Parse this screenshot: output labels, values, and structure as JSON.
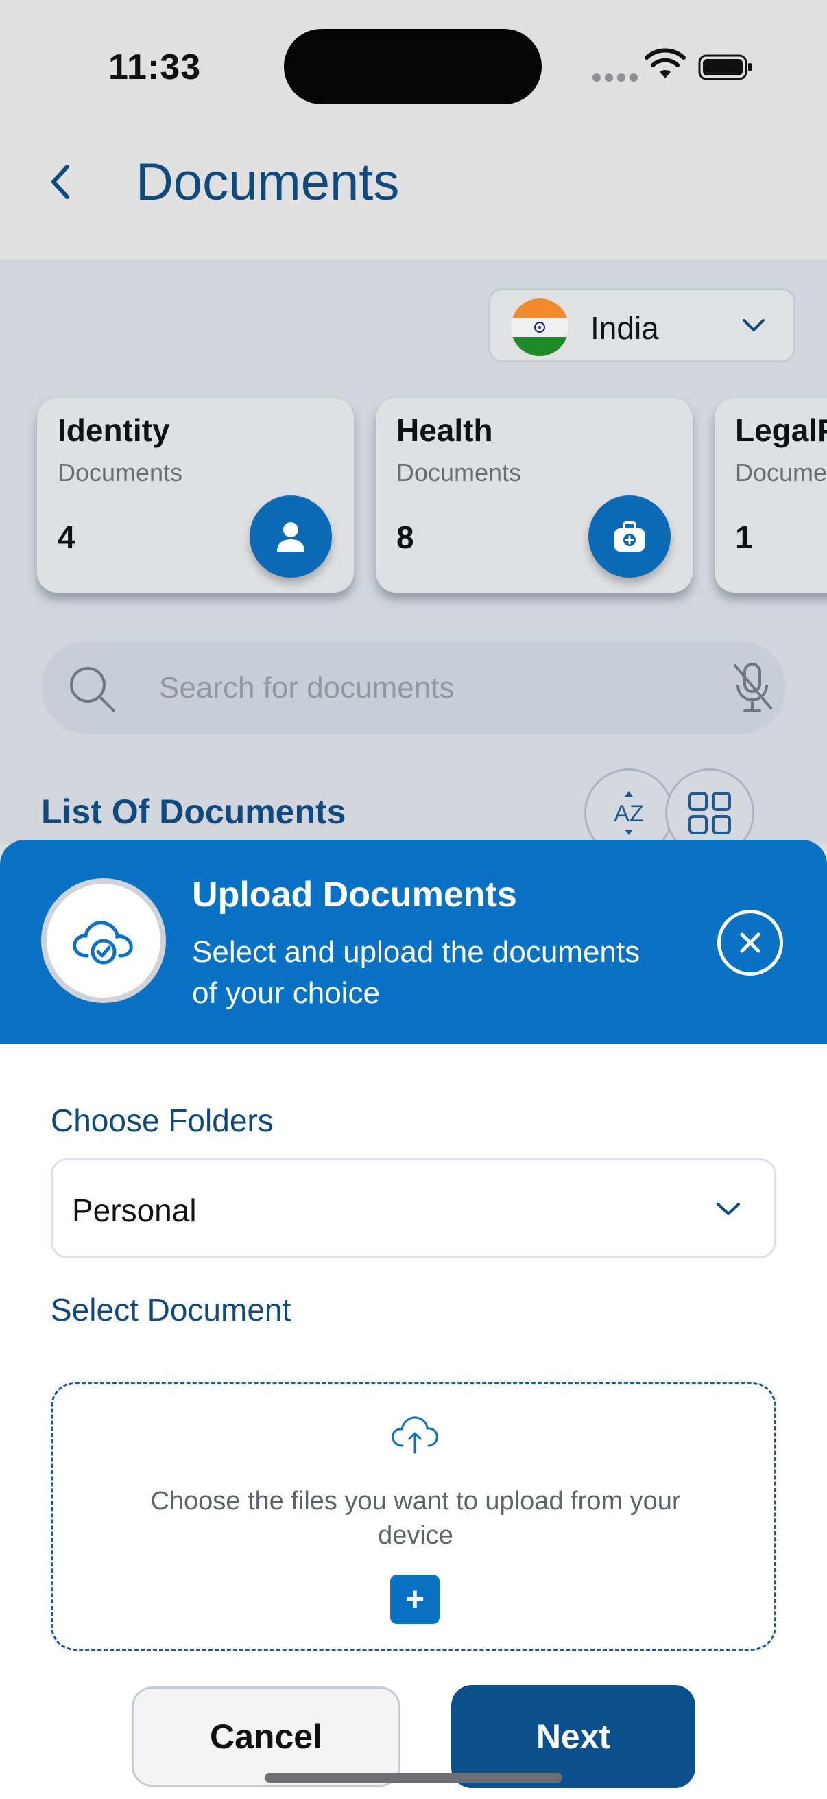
{
  "status_bar": {
    "time": "11:33"
  },
  "header": {
    "title": "Documents"
  },
  "country": {
    "label": "India"
  },
  "categories": [
    {
      "title": "Identity",
      "subtitle": "Documents",
      "count": "4",
      "icon": "person-icon"
    },
    {
      "title": "Health",
      "subtitle": "Documents",
      "count": "8",
      "icon": "medical-kit-icon"
    },
    {
      "title": "LegalF",
      "subtitle": "Docume",
      "count": "1",
      "icon": "legal-icon"
    }
  ],
  "search": {
    "placeholder": "Search for documents"
  },
  "list": {
    "title": "List Of Documents",
    "sort_label": "AZ"
  },
  "upload_sheet": {
    "title": "Upload Documents",
    "description": "Select and upload the documents of your choice",
    "choose_folders_label": "Choose Folders",
    "folder_value": "Personal",
    "select_document_label": "Select Document",
    "dropzone_text": "Choose the files you want to upload from your device",
    "add_label": "+",
    "cancel_label": "Cancel",
    "next_label": "Next"
  },
  "colors": {
    "primary": "#0a72c4",
    "title_blue": "#0e4a7d",
    "next_button": "#0b4f8c",
    "background": "#d2d6dc"
  }
}
